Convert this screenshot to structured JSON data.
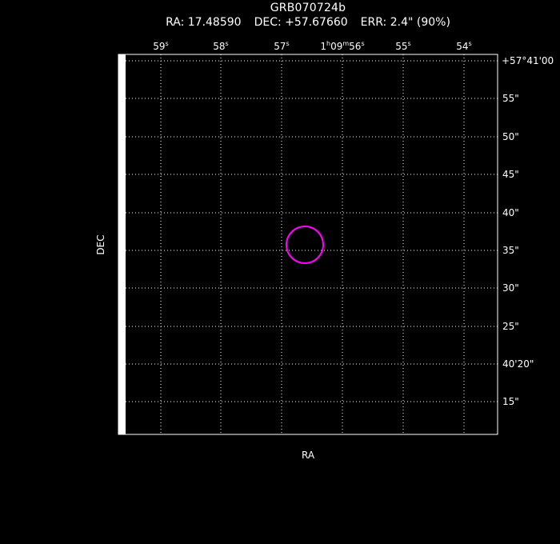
{
  "title": "GRB070724b",
  "subtitle": {
    "ra": "RA: 17.48590",
    "dec": "DEC: +57.67660",
    "err": "ERR: 2.4\" (90%)"
  },
  "axes": {
    "xlabel": "RA",
    "ylabel": "DEC"
  },
  "chart_data": {
    "type": "scatter",
    "title": "GRB070724b",
    "xlabel": "RA",
    "ylabel": "DEC",
    "grid": true,
    "x_ticks": [
      {
        "main": "59",
        "sup": "s"
      },
      {
        "main": "58",
        "sup": "s"
      },
      {
        "main": "57",
        "sup": "s"
      },
      {
        "main": "1",
        "sup": "h",
        "main2": "09",
        "sup2": "m",
        "main3": "56",
        "sup3": "s"
      },
      {
        "main": "55",
        "sup": "s"
      },
      {
        "main": "54",
        "sup": "s"
      }
    ],
    "y_ticks": [
      "+57°41'00",
      "55\"",
      "50\"",
      "45\"",
      "40\"",
      "35\"",
      "30\"",
      "25\"",
      "40'20\"",
      "15\""
    ],
    "error_circle": {
      "ra_deg": 17.4859,
      "dec_deg": 57.6766,
      "radius_arcsec": 2.4,
      "confidence": "90%",
      "color": "#ff00ff"
    }
  },
  "colors": {
    "background": "#000000",
    "foreground": "#ffffff",
    "circle": "#ff00ff"
  }
}
